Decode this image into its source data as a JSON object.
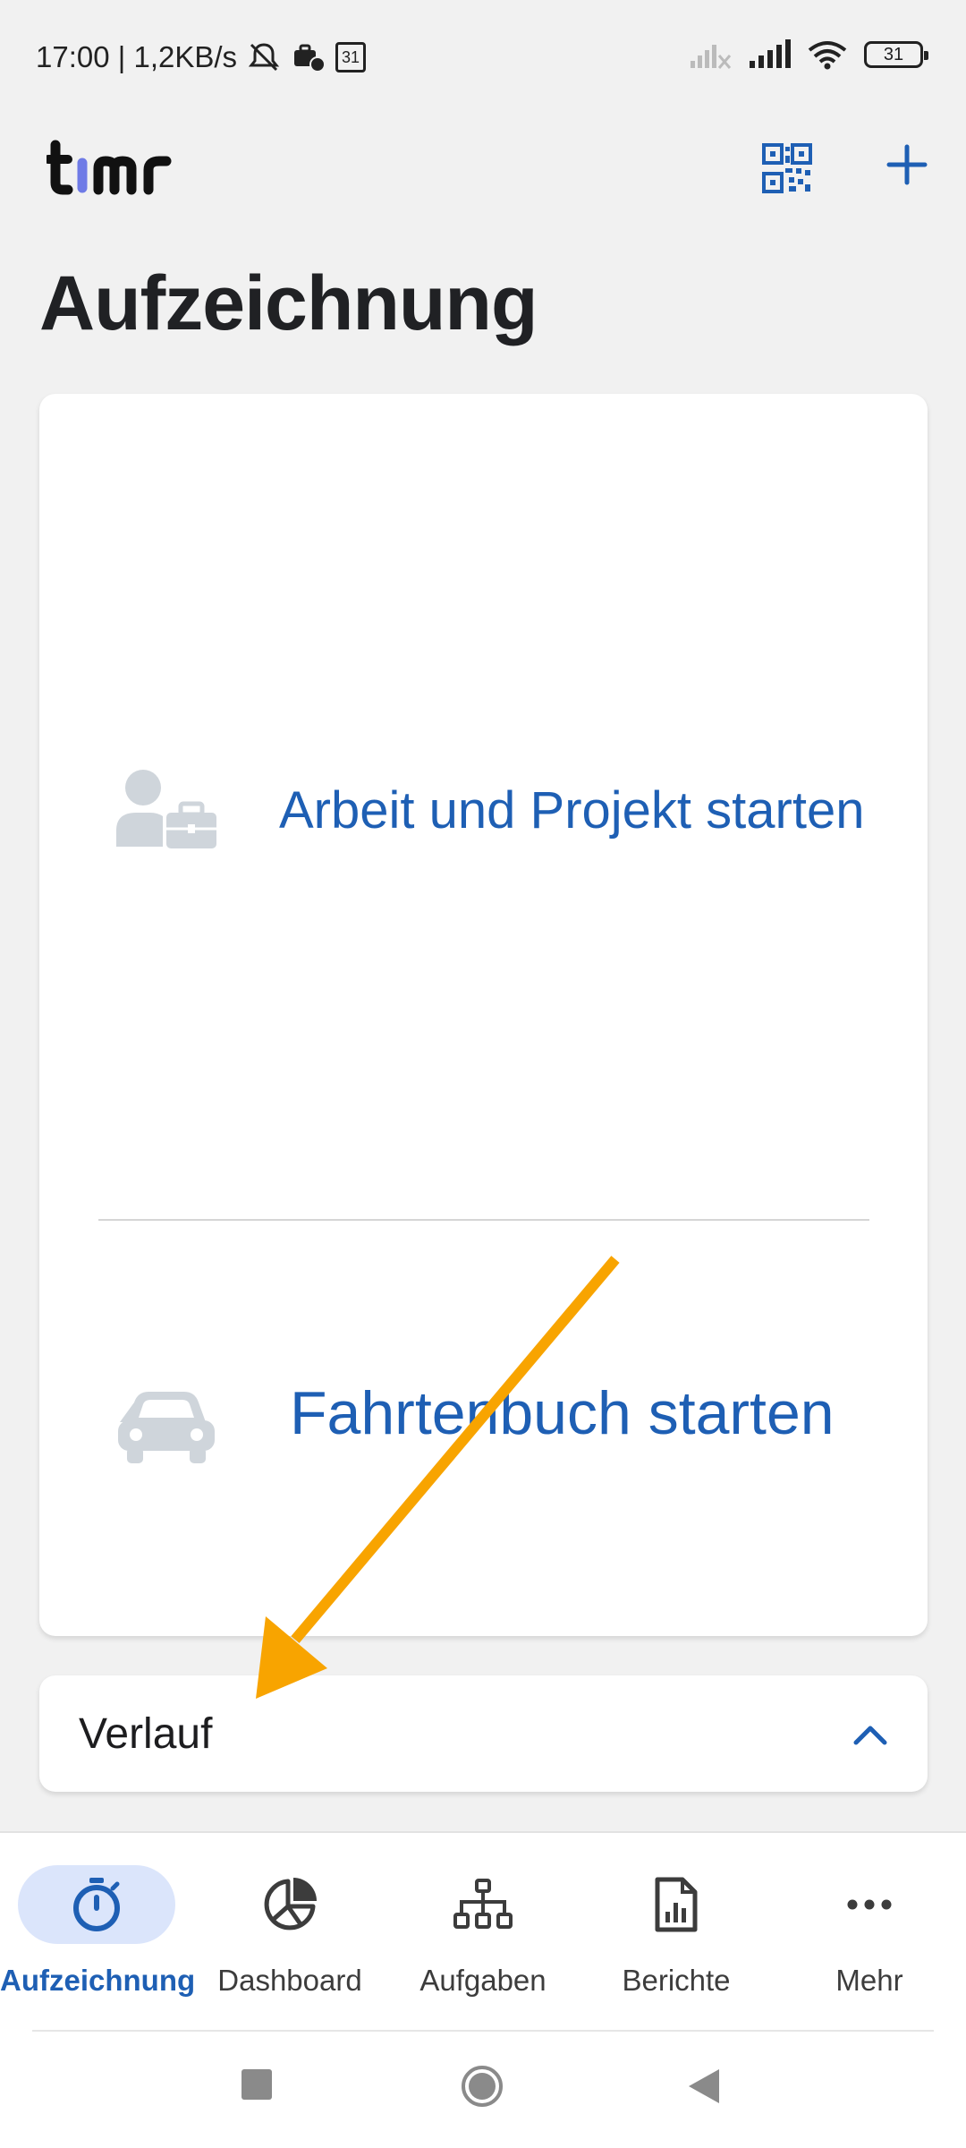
{
  "status_bar": {
    "time_speed": "17:00 | 1,2KB/s",
    "calendar_day": "31",
    "battery": "31"
  },
  "header": {
    "logo": "timr",
    "title": "Aufzeichnung"
  },
  "actions": {
    "work_label": "Arbeit und Projekt starten",
    "trip_label": "Fahrtenbuch starten"
  },
  "history": {
    "label": "Verlauf"
  },
  "bottom_nav": {
    "items": [
      {
        "label": "Aufzeichnung",
        "icon": "stopwatch-icon",
        "active": true
      },
      {
        "label": "Dashboard",
        "icon": "pie-chart-icon",
        "active": false
      },
      {
        "label": "Aufgaben",
        "icon": "hierarchy-icon",
        "active": false
      },
      {
        "label": "Berichte",
        "icon": "report-icon",
        "active": false
      },
      {
        "label": "Mehr",
        "icon": "more-icon",
        "active": false
      }
    ]
  },
  "colors": {
    "accent": "#1e5fb4",
    "active_pill": "#dbe5fb",
    "annotation_arrow": "#f8a400",
    "icon_gray": "#cfd5db"
  }
}
